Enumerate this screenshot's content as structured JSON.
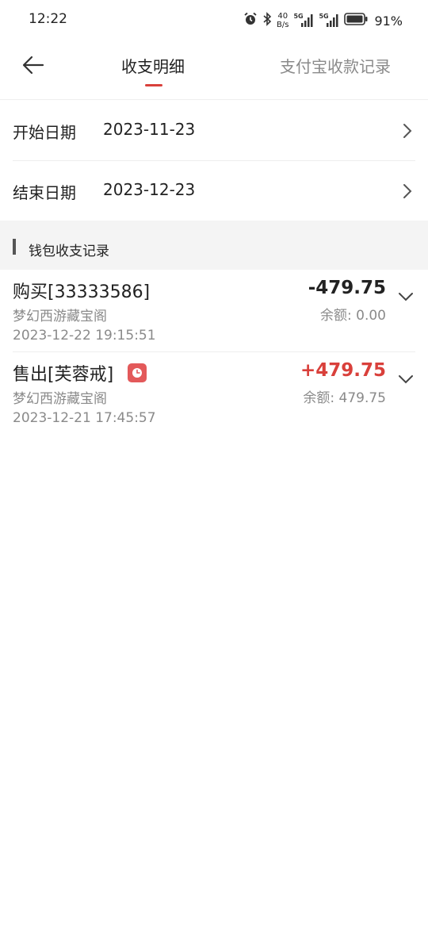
{
  "status_bar": {
    "time": "12:22",
    "net_speed_value": "40",
    "net_speed_unit": "B/s",
    "signal_1_label": "5G",
    "signal_2_label": "5G",
    "battery_percent": "91%",
    "icons": [
      "alarm-icon",
      "bluetooth-icon",
      "signal-icon",
      "signal-icon",
      "battery-icon"
    ]
  },
  "header": {
    "back_icon": "arrow-left-icon",
    "tabs": [
      {
        "label": "收支明细",
        "active": true
      },
      {
        "label": "支付宝收款记录",
        "active": false
      }
    ],
    "accent_color": "#d9403b"
  },
  "filters": {
    "start": {
      "label": "开始日期",
      "value": "2023-11-23"
    },
    "end": {
      "label": "结束日期",
      "value": "2023-12-23"
    }
  },
  "section": {
    "title": "钱包收支记录"
  },
  "transactions": [
    {
      "title": "购买[33333586]",
      "merchant": "梦幻西游藏宝阁",
      "time": "2023-12-22 19:15:51",
      "amount": "-479.75",
      "balance": "余额: 0.00",
      "amount_color": "#222222"
    },
    {
      "title": "售出[芙蓉戒]",
      "merchant": "梦幻西游藏宝阁",
      "time": "2023-12-21 17:45:57",
      "amount": "+479.75",
      "balance": "余额: 479.75",
      "amount_color": "#d9403b",
      "badge_icon": "clock-icon"
    }
  ]
}
